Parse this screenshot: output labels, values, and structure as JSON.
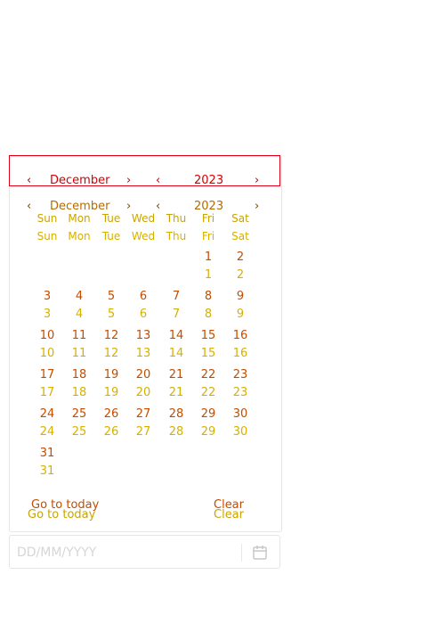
{
  "header": {
    "prev_month": "‹",
    "month": "December",
    "next_month": "›",
    "prev_year": "‹",
    "year": "2023",
    "next_year": "›"
  },
  "weekdays": [
    "Sun",
    "Mon",
    "Tue",
    "Wed",
    "Thu",
    "Fri",
    "Sat"
  ],
  "weeks": [
    [
      "",
      "",
      "",
      "",
      "",
      "1",
      "2"
    ],
    [
      "3",
      "4",
      "5",
      "6",
      "7",
      "8",
      "9"
    ],
    [
      "10",
      "11",
      "12",
      "13",
      "14",
      "15",
      "16"
    ],
    [
      "17",
      "18",
      "19",
      "20",
      "21",
      "22",
      "23"
    ],
    [
      "24",
      "25",
      "26",
      "27",
      "28",
      "29",
      "30"
    ],
    [
      "31",
      "",
      "",
      "",
      "",
      "",
      ""
    ]
  ],
  "footer": {
    "today_label": "Go to today",
    "clear_label": "Clear"
  },
  "input": {
    "placeholder": "DD/MM/YYYY",
    "value": ""
  },
  "colors": {
    "accent_red": "#e0001a",
    "ghost_yellow": "#d6b000"
  }
}
